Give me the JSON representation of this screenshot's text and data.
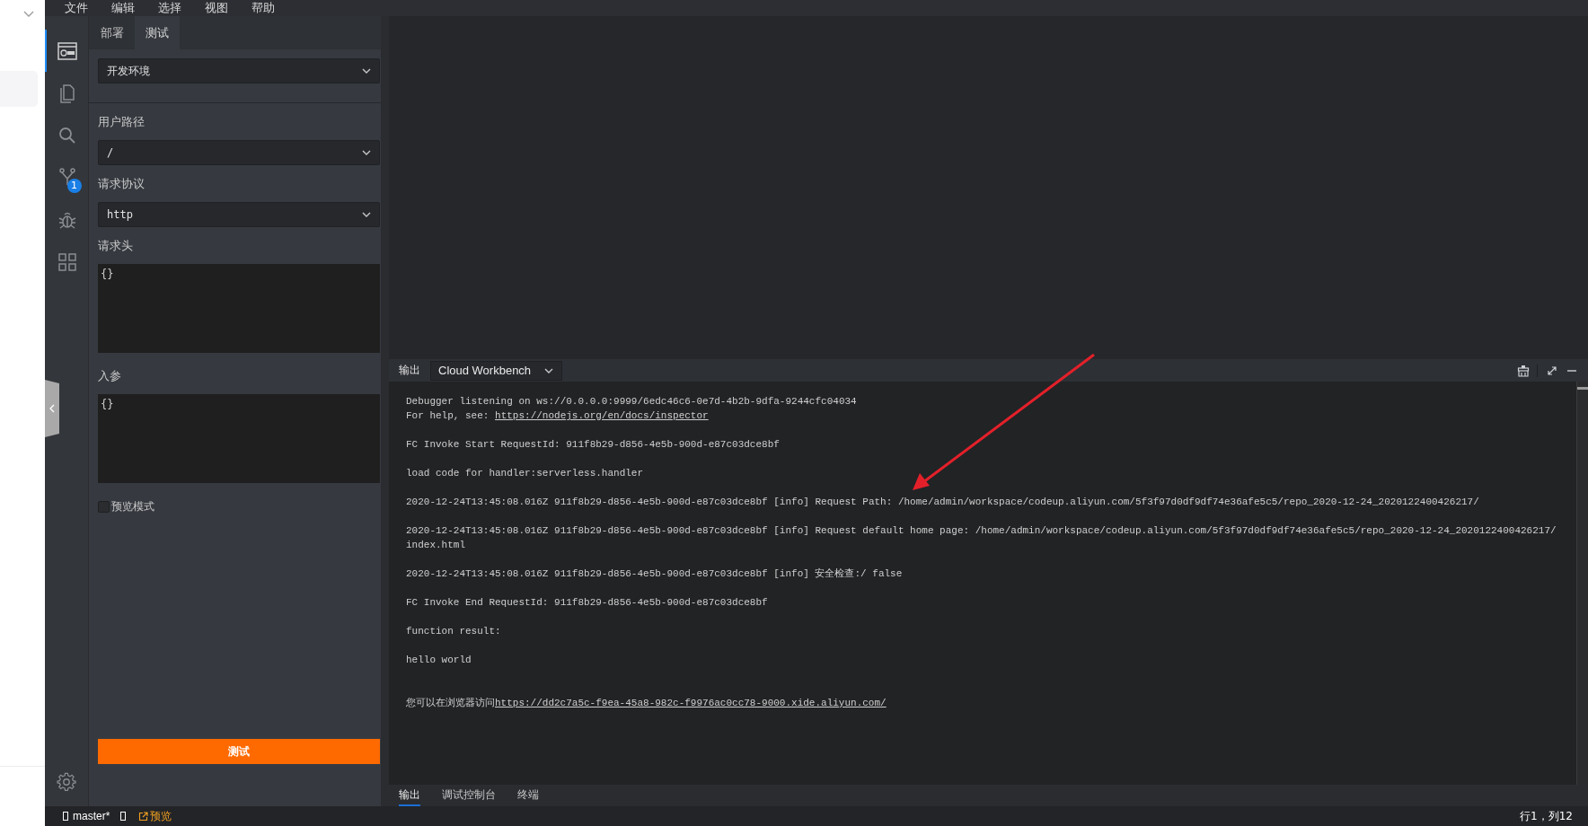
{
  "menu": [
    {
      "label": "文件"
    },
    {
      "label": "编辑"
    },
    {
      "label": "选择"
    },
    {
      "label": "视图"
    },
    {
      "label": "帮助"
    }
  ],
  "activity_bar": {
    "items": [
      {
        "kind": "web",
        "selected": true
      },
      {
        "kind": "files",
        "selected": false
      },
      {
        "kind": "search",
        "selected": false
      },
      {
        "kind": "branch",
        "selected": false,
        "badge": "1"
      },
      {
        "kind": "bug",
        "selected": false
      },
      {
        "kind": "grid",
        "selected": false
      }
    ]
  },
  "side_panel": {
    "tabs": [
      {
        "label": "部署",
        "selected": false
      },
      {
        "label": "测试",
        "selected": true
      }
    ],
    "environment": {
      "value": "开发环境"
    },
    "fields": [
      {
        "kind": "select",
        "label": "用户路径",
        "value": "/"
      },
      {
        "kind": "select",
        "label": "请求协议",
        "value": "http"
      },
      {
        "kind": "textarea",
        "label": "请求头",
        "value": "{}"
      },
      {
        "kind": "textarea",
        "label": "入参",
        "value": "{}"
      }
    ],
    "preview_mode": {
      "label": "预览模式",
      "checked": false
    },
    "test_button": "测试"
  },
  "output_panel": {
    "title": "输出",
    "channel": "Cloud Workbench",
    "log": [
      {
        "lines": [
          {
            "text": "Debugger listening on ws://0.0.0.0:9999/6edc46c6-0e7d-4b2b-9dfa-9244cfc04034"
          },
          {
            "text": "For help, see: ",
            "link": "https://nodejs.org/en/docs/inspector"
          }
        ]
      },
      {
        "lines": [
          {
            "text": "FC Invoke Start RequestId: 911f8b29-d856-4e5b-900d-e87c03dce8bf"
          }
        ]
      },
      {
        "lines": [
          {
            "text": "load code for handler:serverless.handler"
          }
        ]
      },
      {
        "lines": [
          {
            "text": "2020-12-24T13:45:08.016Z 911f8b29-d856-4e5b-900d-e87c03dce8bf [info] Request Path: /home/admin/workspace/codeup.aliyun.com/5f3f97d0df9df74e36afe5c5/repo_2020-12-24_2020122400426217/"
          }
        ]
      },
      {
        "lines": [
          {
            "text": "2020-12-24T13:45:08.016Z 911f8b29-d856-4e5b-900d-e87c03dce8bf [info] Request default home page: /home/admin/workspace/codeup.aliyun.com/5f3f97d0df9df74e36afe5c5/repo_2020-12-24_2020122400426217/"
          },
          {
            "text": "index.html"
          }
        ]
      },
      {
        "lines": [
          {
            "text": "2020-12-24T13:45:08.016Z 911f8b29-d856-4e5b-900d-e87c03dce8bf [info] 安全检查:/ false"
          }
        ]
      },
      {
        "lines": [
          {
            "text": "FC Invoke End RequestId: 911f8b29-d856-4e5b-900d-e87c03dce8bf"
          }
        ]
      },
      {
        "lines": [
          {
            "text": "function result:"
          }
        ]
      },
      {
        "lines": [
          {
            "text": "hello world"
          }
        ]
      },
      {
        "lines": [
          {
            "text": "您可以在浏览器访问",
            "link": "https://dd2c7a5c-f9ea-45a8-982c-f9976ac0cc78-9000.xide.aliyun.com/"
          }
        ]
      }
    ],
    "tabs": [
      {
        "label": "输出",
        "selected": true
      },
      {
        "label": "调试控制台",
        "selected": false
      },
      {
        "label": "终端",
        "selected": false
      }
    ]
  },
  "status_bar": {
    "branch": "master*",
    "preview": "预览",
    "cursor": "行1，列12"
  }
}
